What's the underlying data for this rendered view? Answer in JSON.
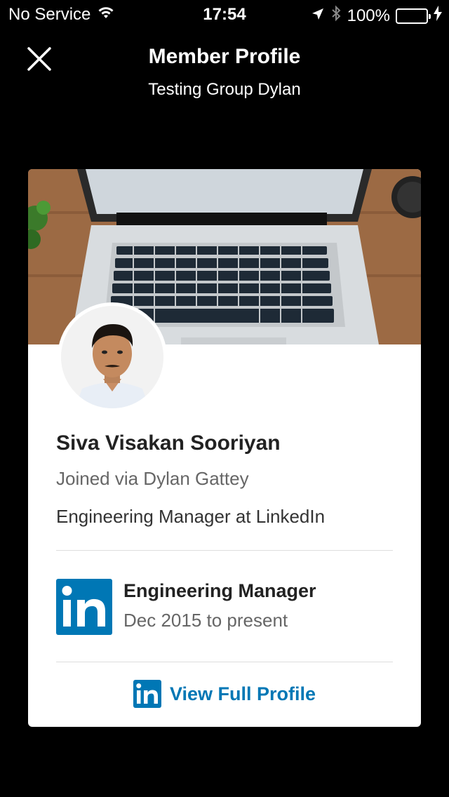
{
  "status_bar": {
    "carrier": "No Service",
    "time": "17:54",
    "battery": "100%",
    "battery_level": 1.0,
    "icons": [
      "wifi-icon",
      "location-arrow-icon",
      "bluetooth-icon",
      "battery-icon",
      "charging-icon"
    ]
  },
  "header": {
    "title": "Member Profile",
    "subtitle": "Testing Group Dylan",
    "close_icon": "close-icon"
  },
  "profile": {
    "name": "Siva Visakan Sooriyan",
    "joined": "Joined via Dylan Gattey",
    "headline": "Engineering Manager at LinkedIn",
    "position": {
      "title": "Engineering Manager",
      "dates": "Dec 2015 to present",
      "company_logo": "linkedin-logo-icon"
    },
    "view_full_profile": "View Full Profile"
  },
  "colors": {
    "linkedin_blue": "#0077b5",
    "battery_green": "#4cd964",
    "background": "#000000",
    "card": "#ffffff"
  }
}
